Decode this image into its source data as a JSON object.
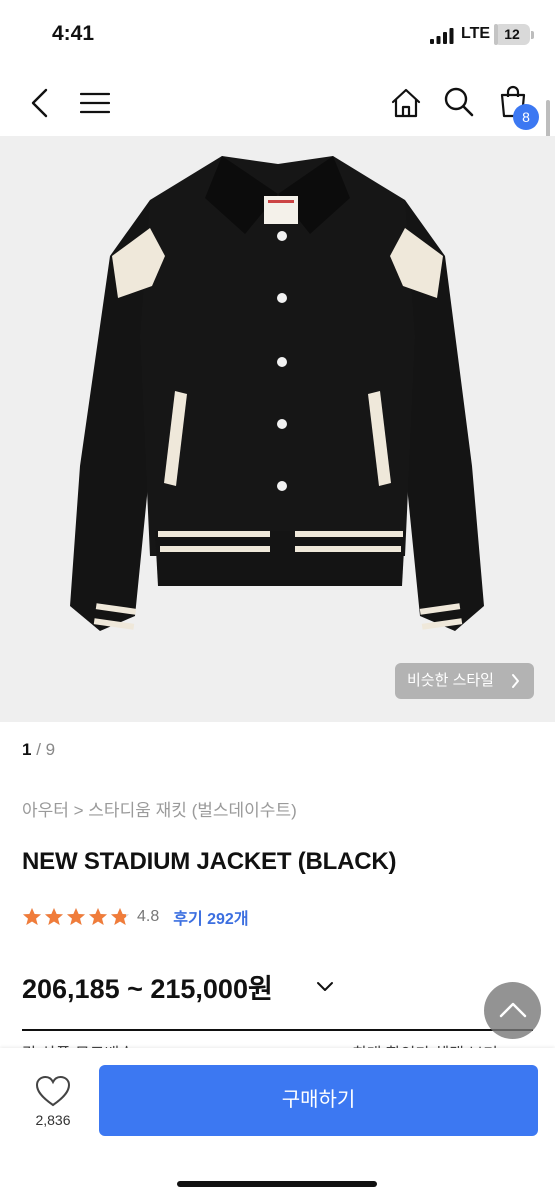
{
  "status_bar": {
    "time": "4:41",
    "network": "LTE",
    "battery": "12",
    "battery_level": 0.12
  },
  "nav": {
    "cart_count": "8"
  },
  "hero": {
    "similar_style_label": "비슷한 스타일"
  },
  "pager": {
    "current": "1",
    "separator": " / ",
    "total": "9"
  },
  "product": {
    "breadcrumb": "아우터 > 스타디움 재킷 (벌스데이수트)",
    "title": "NEW STADIUM JACKET (BLACK)",
    "rating_value": 4.8,
    "rating_text": "4.8",
    "review_label": "후기 292개",
    "price": "206,185 ~ 215,000원"
  },
  "cutoff": {
    "left": "각 상품 무료배송",
    "right": "최대 할인가 혜택 보기"
  },
  "bottom_bar": {
    "like_count": "2,836",
    "buy_label": "구매하기"
  },
  "colors": {
    "accent": "#3c78f2",
    "review_link": "#3c6fe0",
    "star": "#f07c3a"
  },
  "icons": [
    "back-arrow-icon",
    "menu-icon",
    "home-icon",
    "search-icon",
    "cart-icon",
    "chevron-right-icon",
    "chevron-down-icon",
    "chevron-up-icon",
    "heart-icon",
    "star-icon"
  ]
}
